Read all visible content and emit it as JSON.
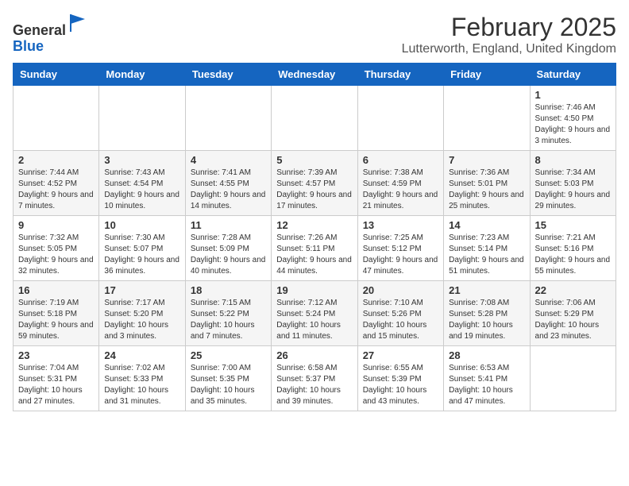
{
  "header": {
    "logo_line1": "General",
    "logo_line2": "Blue",
    "title": "February 2025",
    "subtitle": "Lutterworth, England, United Kingdom"
  },
  "days_of_week": [
    "Sunday",
    "Monday",
    "Tuesday",
    "Wednesday",
    "Thursday",
    "Friday",
    "Saturday"
  ],
  "weeks": [
    [
      {
        "day": "",
        "info": ""
      },
      {
        "day": "",
        "info": ""
      },
      {
        "day": "",
        "info": ""
      },
      {
        "day": "",
        "info": ""
      },
      {
        "day": "",
        "info": ""
      },
      {
        "day": "",
        "info": ""
      },
      {
        "day": "1",
        "info": "Sunrise: 7:46 AM\nSunset: 4:50 PM\nDaylight: 9 hours and 3 minutes."
      }
    ],
    [
      {
        "day": "2",
        "info": "Sunrise: 7:44 AM\nSunset: 4:52 PM\nDaylight: 9 hours and 7 minutes."
      },
      {
        "day": "3",
        "info": "Sunrise: 7:43 AM\nSunset: 4:54 PM\nDaylight: 9 hours and 10 minutes."
      },
      {
        "day": "4",
        "info": "Sunrise: 7:41 AM\nSunset: 4:55 PM\nDaylight: 9 hours and 14 minutes."
      },
      {
        "day": "5",
        "info": "Sunrise: 7:39 AM\nSunset: 4:57 PM\nDaylight: 9 hours and 17 minutes."
      },
      {
        "day": "6",
        "info": "Sunrise: 7:38 AM\nSunset: 4:59 PM\nDaylight: 9 hours and 21 minutes."
      },
      {
        "day": "7",
        "info": "Sunrise: 7:36 AM\nSunset: 5:01 PM\nDaylight: 9 hours and 25 minutes."
      },
      {
        "day": "8",
        "info": "Sunrise: 7:34 AM\nSunset: 5:03 PM\nDaylight: 9 hours and 29 minutes."
      }
    ],
    [
      {
        "day": "9",
        "info": "Sunrise: 7:32 AM\nSunset: 5:05 PM\nDaylight: 9 hours and 32 minutes."
      },
      {
        "day": "10",
        "info": "Sunrise: 7:30 AM\nSunset: 5:07 PM\nDaylight: 9 hours and 36 minutes."
      },
      {
        "day": "11",
        "info": "Sunrise: 7:28 AM\nSunset: 5:09 PM\nDaylight: 9 hours and 40 minutes."
      },
      {
        "day": "12",
        "info": "Sunrise: 7:26 AM\nSunset: 5:11 PM\nDaylight: 9 hours and 44 minutes."
      },
      {
        "day": "13",
        "info": "Sunrise: 7:25 AM\nSunset: 5:12 PM\nDaylight: 9 hours and 47 minutes."
      },
      {
        "day": "14",
        "info": "Sunrise: 7:23 AM\nSunset: 5:14 PM\nDaylight: 9 hours and 51 minutes."
      },
      {
        "day": "15",
        "info": "Sunrise: 7:21 AM\nSunset: 5:16 PM\nDaylight: 9 hours and 55 minutes."
      }
    ],
    [
      {
        "day": "16",
        "info": "Sunrise: 7:19 AM\nSunset: 5:18 PM\nDaylight: 9 hours and 59 minutes."
      },
      {
        "day": "17",
        "info": "Sunrise: 7:17 AM\nSunset: 5:20 PM\nDaylight: 10 hours and 3 minutes."
      },
      {
        "day": "18",
        "info": "Sunrise: 7:15 AM\nSunset: 5:22 PM\nDaylight: 10 hours and 7 minutes."
      },
      {
        "day": "19",
        "info": "Sunrise: 7:12 AM\nSunset: 5:24 PM\nDaylight: 10 hours and 11 minutes."
      },
      {
        "day": "20",
        "info": "Sunrise: 7:10 AM\nSunset: 5:26 PM\nDaylight: 10 hours and 15 minutes."
      },
      {
        "day": "21",
        "info": "Sunrise: 7:08 AM\nSunset: 5:28 PM\nDaylight: 10 hours and 19 minutes."
      },
      {
        "day": "22",
        "info": "Sunrise: 7:06 AM\nSunset: 5:29 PM\nDaylight: 10 hours and 23 minutes."
      }
    ],
    [
      {
        "day": "23",
        "info": "Sunrise: 7:04 AM\nSunset: 5:31 PM\nDaylight: 10 hours and 27 minutes."
      },
      {
        "day": "24",
        "info": "Sunrise: 7:02 AM\nSunset: 5:33 PM\nDaylight: 10 hours and 31 minutes."
      },
      {
        "day": "25",
        "info": "Sunrise: 7:00 AM\nSunset: 5:35 PM\nDaylight: 10 hours and 35 minutes."
      },
      {
        "day": "26",
        "info": "Sunrise: 6:58 AM\nSunset: 5:37 PM\nDaylight: 10 hours and 39 minutes."
      },
      {
        "day": "27",
        "info": "Sunrise: 6:55 AM\nSunset: 5:39 PM\nDaylight: 10 hours and 43 minutes."
      },
      {
        "day": "28",
        "info": "Sunrise: 6:53 AM\nSunset: 5:41 PM\nDaylight: 10 hours and 47 minutes."
      },
      {
        "day": "",
        "info": ""
      }
    ]
  ]
}
